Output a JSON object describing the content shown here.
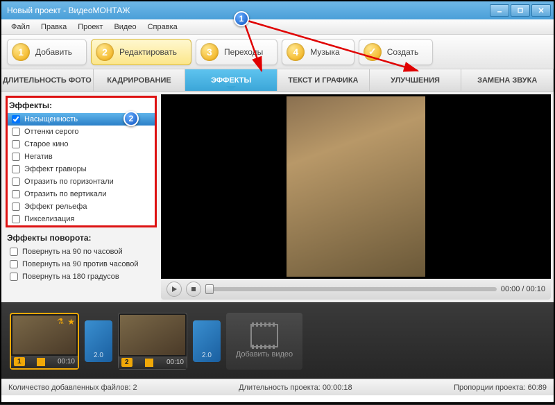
{
  "window": {
    "title": "Новый проект - ВидеоМОНТАЖ"
  },
  "menu": [
    "Файл",
    "Правка",
    "Проект",
    "Видео",
    "Справка"
  ],
  "steps": [
    {
      "num": "1",
      "label": "Добавить"
    },
    {
      "num": "2",
      "label": "Редактировать"
    },
    {
      "num": "3",
      "label": "Переходы"
    },
    {
      "num": "4",
      "label": "Музыка"
    },
    {
      "num": "✓",
      "label": "Создать"
    }
  ],
  "active_step": 1,
  "subtabs": [
    "ДЛИТЕЛЬНОСТЬ ФОТО",
    "КАДРИРОВАНИЕ",
    "ЭФФЕКТЫ",
    "ТЕКСТ И ГРАФИКА",
    "УЛУЧШЕНИЯ",
    "ЗАМЕНА ЗВУКА"
  ],
  "active_subtab": 2,
  "effects_title": "Эффекты:",
  "effects": [
    {
      "label": "Насыщенность",
      "checked": true,
      "selected": true
    },
    {
      "label": "Оттенки серого",
      "checked": false
    },
    {
      "label": "Старое кино",
      "checked": false
    },
    {
      "label": "Негатив",
      "checked": false
    },
    {
      "label": "Эффект гравюры",
      "checked": false
    },
    {
      "label": "Отразить по горизонтали",
      "checked": false
    },
    {
      "label": "Отразить по вертикали",
      "checked": false
    },
    {
      "label": "Эффект рельефа",
      "checked": false
    },
    {
      "label": "Пикселизация",
      "checked": false
    }
  ],
  "rotate_title": "Эффекты поворота:",
  "rotations": [
    {
      "label": "Повернуть на 90 по часовой"
    },
    {
      "label": "Повернуть на 90 против часовой"
    },
    {
      "label": "Повернуть на 180 градусов"
    }
  ],
  "player": {
    "current": "00:00",
    "total": "00:10",
    "sep": "/"
  },
  "timeline": {
    "clips": [
      {
        "index": "1",
        "duration": "00:10",
        "selected": true
      },
      {
        "index": "2",
        "duration": "00:10",
        "selected": false
      }
    ],
    "transitions": [
      {
        "label": "2.0"
      },
      {
        "label": "2.0"
      }
    ],
    "add_label": "Добавить видео"
  },
  "status": {
    "files_label": "Количество добавленных файлов:",
    "files_value": "2",
    "duration_label": "Длительность проекта:",
    "duration_value": "00:00:18",
    "ratio_label": "Пропорции проекта:",
    "ratio_value": "60:89"
  },
  "annotations": {
    "b1": "1",
    "b2": "2"
  }
}
